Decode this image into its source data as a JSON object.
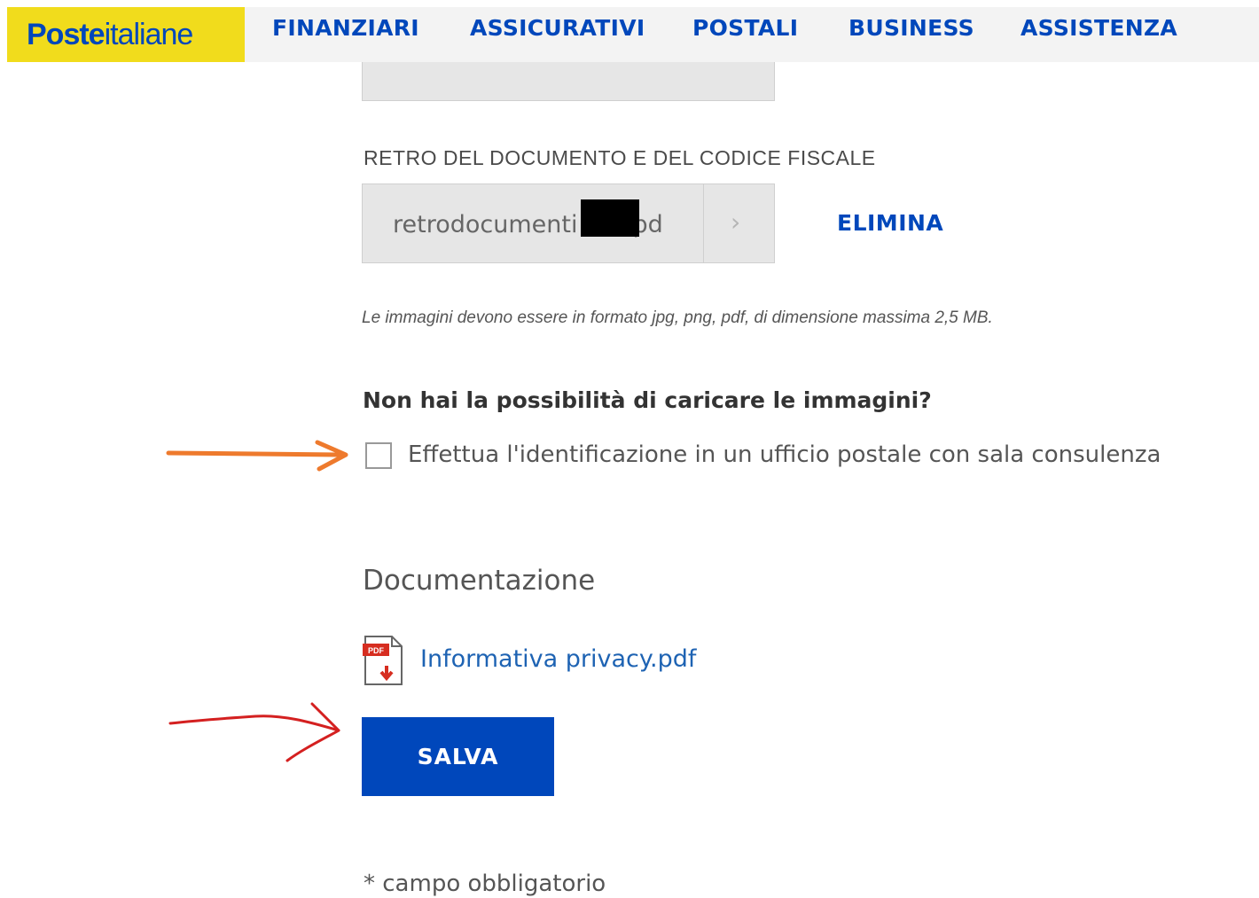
{
  "header": {
    "logo": {
      "bold": "Poste",
      "regular": "italiane"
    },
    "nav": [
      "FINANZIARI",
      "ASSICURATIVI",
      "POSTALI",
      "BUSINESS",
      "ASSISTENZA"
    ]
  },
  "upload": {
    "retro_label": "RETRO DEL DOCUMENTO E DEL CODICE FISCALE",
    "retro_file_start": "retrodocumenti",
    "retro_file_end": "pd",
    "delete_label": "ELIMINA",
    "format_note": "Le immagini devono essere in formato jpg, png, pdf, di dimensione massima 2,5 MB."
  },
  "identification": {
    "question": "Non hai la possibilità di caricare le immagini?",
    "checkbox_label": "Effettua l'identificazione in un ufficio postale con sala consulenza",
    "checked": false
  },
  "documentation": {
    "title": "Documentazione",
    "pdf_badge": "PDF",
    "file_link": "Informativa privacy.pdf"
  },
  "actions": {
    "save_label": "SALVA"
  },
  "footer": {
    "required_note": "* campo obbligatorio"
  },
  "colors": {
    "brand_blue": "#0047bb",
    "brand_yellow": "#f1dc1c",
    "arrow_orange": "#ee7a2d",
    "arrow_red": "#d42020"
  },
  "icons": [
    "pdf-file-icon",
    "chevron-right-icon",
    "annotation-arrow-orange",
    "annotation-arrow-red"
  ]
}
